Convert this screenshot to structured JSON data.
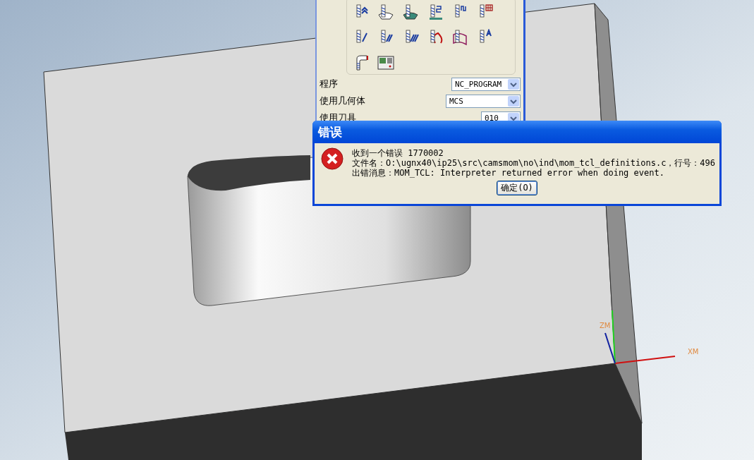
{
  "panel": {
    "fields": [
      {
        "label": "程序",
        "value": "NC_PROGRAM"
      },
      {
        "label": "使用几何体",
        "value": "MCS"
      },
      {
        "label": "使用刀具",
        "value": "010"
      }
    ]
  },
  "dialog": {
    "title": "错误",
    "lines": [
      "收到一个错误 1770002",
      "文件名：O:\\ugnx40\\ip25\\src\\camsmom\\no\\ind\\mom_tcl_definitions.c，行号：496",
      "出错消息：MOM_TCL: Interpreter returned error when doing event."
    ],
    "button": "确定(O)"
  },
  "viewport": {
    "axis_labels": [
      "ZM",
      "XM"
    ]
  }
}
